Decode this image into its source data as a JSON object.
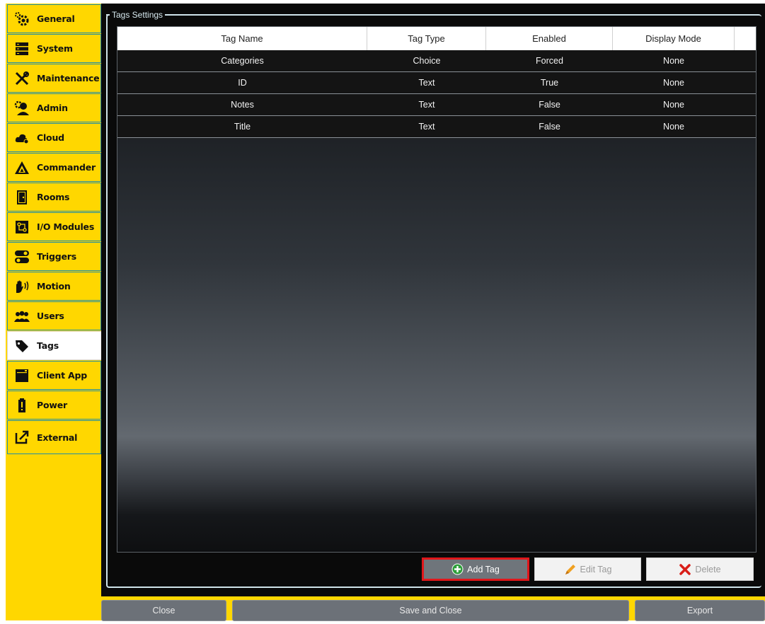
{
  "sidebar": {
    "items": [
      {
        "label": "General",
        "icon": "gear-icon"
      },
      {
        "label": "System",
        "icon": "server-icon"
      },
      {
        "label": "Maintenance",
        "icon": "tools-icon"
      },
      {
        "label": "Admin",
        "icon": "admin-icon"
      },
      {
        "label": "Cloud",
        "icon": "cloud-icon"
      },
      {
        "label": "Commander",
        "icon": "commander-icon"
      },
      {
        "label": "Rooms",
        "icon": "door-icon"
      },
      {
        "label": "I/O Modules",
        "icon": "io-module-icon"
      },
      {
        "label": "Triggers",
        "icon": "toggle-icon"
      },
      {
        "label": "Motion",
        "icon": "motion-hand-icon"
      },
      {
        "label": "Users",
        "icon": "users-icon"
      },
      {
        "label": "Tags",
        "icon": "tag-icon"
      },
      {
        "label": "Client App",
        "icon": "window-icon"
      },
      {
        "label": "Power",
        "icon": "battery-icon"
      },
      {
        "label": "External",
        "icon": "external-link-icon"
      }
    ],
    "active": "Tags"
  },
  "panel": {
    "title": "Tags Settings"
  },
  "table": {
    "columns": [
      "Tag Name",
      "Tag Type",
      "Enabled",
      "Display Mode"
    ],
    "rows": [
      [
        "Categories",
        "Choice",
        "Forced",
        "None"
      ],
      [
        "ID",
        "Text",
        "True",
        "None"
      ],
      [
        "Notes",
        "Text",
        "False",
        "None"
      ],
      [
        "Title",
        "Text",
        "False",
        "None"
      ]
    ]
  },
  "actions": {
    "add_label": "Add Tag",
    "edit_label": "Edit Tag",
    "delete_label": "Delete"
  },
  "footer": {
    "close_label": "Close",
    "save_close_label": "Save and Close",
    "export_label": "Export"
  },
  "colors": {
    "accent": "#FFD700",
    "sidebar_border": "#1f8ea8",
    "highlight_red": "#e0171b"
  }
}
